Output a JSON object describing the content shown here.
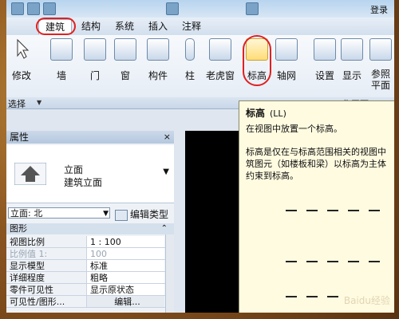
{
  "window": {
    "login_text": "登录"
  },
  "tabs": [
    {
      "label": "建筑",
      "active": true
    },
    {
      "label": "结构"
    },
    {
      "label": "系统"
    },
    {
      "label": "插入"
    },
    {
      "label": "注释"
    }
  ],
  "ribbon": {
    "buttons": [
      {
        "label": "修改",
        "icon": "modify-arrow-icon"
      },
      {
        "label": "墙",
        "icon": "wall-icon"
      },
      {
        "label": "门",
        "icon": "door-icon"
      },
      {
        "label": "窗",
        "icon": "window-icon"
      },
      {
        "label": "构件",
        "icon": "component-icon"
      },
      {
        "label": "柱",
        "icon": "column-icon"
      },
      {
        "label": "老虎窗",
        "icon": "dormer-icon"
      },
      {
        "label": "标高",
        "icon": "level-icon"
      },
      {
        "label": "轴网",
        "icon": "grid-icon"
      },
      {
        "label": "设置",
        "icon": "settings-icon"
      },
      {
        "label": "显示",
        "icon": "show-icon"
      },
      {
        "label": "参照平面",
        "icon": "ref-plane-icon"
      }
    ],
    "select_label": "选择",
    "panel_fragment": "工作平面"
  },
  "properties": {
    "title": "属性",
    "close": "×",
    "type_line1": "立面",
    "type_line2": "建筑立面",
    "selector_value": "立面: 北",
    "edit_type": "编辑类型",
    "section": "图形",
    "rows": [
      {
        "k": "视图比例",
        "v": "1 : 100"
      },
      {
        "k": "比例值 1:",
        "v": "100",
        "muted": true
      },
      {
        "k": "显示模型",
        "v": "标准"
      },
      {
        "k": "详细程度",
        "v": "粗略"
      },
      {
        "k": "零件可见性",
        "v": "显示原状态"
      },
      {
        "k": "可见性/图形...",
        "v": "编辑..."
      }
    ]
  },
  "tooltip": {
    "title": "标高",
    "shortcut": "(LL)",
    "line1": "在视图中放置一个标高。",
    "desc": [
      "标高是仅在与标高范围相关的视图中",
      "筑图元（如楼板和梁）以标高为主体",
      "约束到标高。"
    ]
  },
  "watermark": "Baidu经验"
}
